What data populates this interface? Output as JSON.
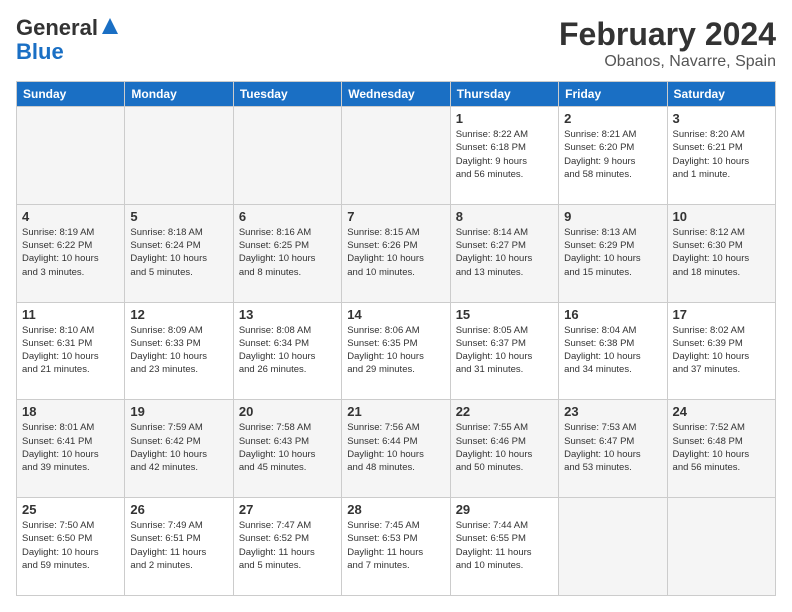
{
  "logo": {
    "line1": "General",
    "line2": "Blue"
  },
  "title": "February 2024",
  "subtitle": "Obanos, Navarre, Spain",
  "weekdays": [
    "Sunday",
    "Monday",
    "Tuesday",
    "Wednesday",
    "Thursday",
    "Friday",
    "Saturday"
  ],
  "rows": [
    [
      {
        "day": "",
        "info": ""
      },
      {
        "day": "",
        "info": ""
      },
      {
        "day": "",
        "info": ""
      },
      {
        "day": "",
        "info": ""
      },
      {
        "day": "1",
        "info": "Sunrise: 8:22 AM\nSunset: 6:18 PM\nDaylight: 9 hours\nand 56 minutes."
      },
      {
        "day": "2",
        "info": "Sunrise: 8:21 AM\nSunset: 6:20 PM\nDaylight: 9 hours\nand 58 minutes."
      },
      {
        "day": "3",
        "info": "Sunrise: 8:20 AM\nSunset: 6:21 PM\nDaylight: 10 hours\nand 1 minute."
      }
    ],
    [
      {
        "day": "4",
        "info": "Sunrise: 8:19 AM\nSunset: 6:22 PM\nDaylight: 10 hours\nand 3 minutes."
      },
      {
        "day": "5",
        "info": "Sunrise: 8:18 AM\nSunset: 6:24 PM\nDaylight: 10 hours\nand 5 minutes."
      },
      {
        "day": "6",
        "info": "Sunrise: 8:16 AM\nSunset: 6:25 PM\nDaylight: 10 hours\nand 8 minutes."
      },
      {
        "day": "7",
        "info": "Sunrise: 8:15 AM\nSunset: 6:26 PM\nDaylight: 10 hours\nand 10 minutes."
      },
      {
        "day": "8",
        "info": "Sunrise: 8:14 AM\nSunset: 6:27 PM\nDaylight: 10 hours\nand 13 minutes."
      },
      {
        "day": "9",
        "info": "Sunrise: 8:13 AM\nSunset: 6:29 PM\nDaylight: 10 hours\nand 15 minutes."
      },
      {
        "day": "10",
        "info": "Sunrise: 8:12 AM\nSunset: 6:30 PM\nDaylight: 10 hours\nand 18 minutes."
      }
    ],
    [
      {
        "day": "11",
        "info": "Sunrise: 8:10 AM\nSunset: 6:31 PM\nDaylight: 10 hours\nand 21 minutes."
      },
      {
        "day": "12",
        "info": "Sunrise: 8:09 AM\nSunset: 6:33 PM\nDaylight: 10 hours\nand 23 minutes."
      },
      {
        "day": "13",
        "info": "Sunrise: 8:08 AM\nSunset: 6:34 PM\nDaylight: 10 hours\nand 26 minutes."
      },
      {
        "day": "14",
        "info": "Sunrise: 8:06 AM\nSunset: 6:35 PM\nDaylight: 10 hours\nand 29 minutes."
      },
      {
        "day": "15",
        "info": "Sunrise: 8:05 AM\nSunset: 6:37 PM\nDaylight: 10 hours\nand 31 minutes."
      },
      {
        "day": "16",
        "info": "Sunrise: 8:04 AM\nSunset: 6:38 PM\nDaylight: 10 hours\nand 34 minutes."
      },
      {
        "day": "17",
        "info": "Sunrise: 8:02 AM\nSunset: 6:39 PM\nDaylight: 10 hours\nand 37 minutes."
      }
    ],
    [
      {
        "day": "18",
        "info": "Sunrise: 8:01 AM\nSunset: 6:41 PM\nDaylight: 10 hours\nand 39 minutes."
      },
      {
        "day": "19",
        "info": "Sunrise: 7:59 AM\nSunset: 6:42 PM\nDaylight: 10 hours\nand 42 minutes."
      },
      {
        "day": "20",
        "info": "Sunrise: 7:58 AM\nSunset: 6:43 PM\nDaylight: 10 hours\nand 45 minutes."
      },
      {
        "day": "21",
        "info": "Sunrise: 7:56 AM\nSunset: 6:44 PM\nDaylight: 10 hours\nand 48 minutes."
      },
      {
        "day": "22",
        "info": "Sunrise: 7:55 AM\nSunset: 6:46 PM\nDaylight: 10 hours\nand 50 minutes."
      },
      {
        "day": "23",
        "info": "Sunrise: 7:53 AM\nSunset: 6:47 PM\nDaylight: 10 hours\nand 53 minutes."
      },
      {
        "day": "24",
        "info": "Sunrise: 7:52 AM\nSunset: 6:48 PM\nDaylight: 10 hours\nand 56 minutes."
      }
    ],
    [
      {
        "day": "25",
        "info": "Sunrise: 7:50 AM\nSunset: 6:50 PM\nDaylight: 10 hours\nand 59 minutes."
      },
      {
        "day": "26",
        "info": "Sunrise: 7:49 AM\nSunset: 6:51 PM\nDaylight: 11 hours\nand 2 minutes."
      },
      {
        "day": "27",
        "info": "Sunrise: 7:47 AM\nSunset: 6:52 PM\nDaylight: 11 hours\nand 5 minutes."
      },
      {
        "day": "28",
        "info": "Sunrise: 7:45 AM\nSunset: 6:53 PM\nDaylight: 11 hours\nand 7 minutes."
      },
      {
        "day": "29",
        "info": "Sunrise: 7:44 AM\nSunset: 6:55 PM\nDaylight: 11 hours\nand 10 minutes."
      },
      {
        "day": "",
        "info": ""
      },
      {
        "day": "",
        "info": ""
      }
    ]
  ]
}
